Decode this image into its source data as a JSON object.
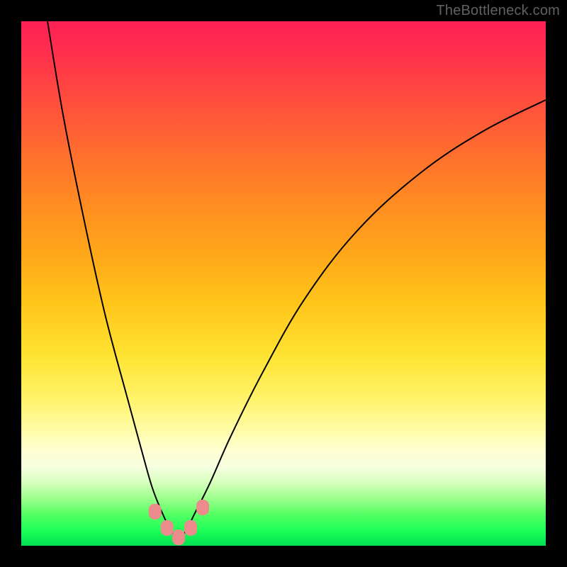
{
  "watermark": "TheBottleneck.com",
  "chart_data": {
    "type": "line",
    "title": "",
    "xlabel": "",
    "ylabel": "",
    "xlim": [
      0,
      100
    ],
    "ylim": [
      0,
      100
    ],
    "grid": false,
    "legend": false,
    "background_gradient": {
      "direction": "vertical",
      "stops": [
        {
          "pos": 0.0,
          "color": "#ff1f55"
        },
        {
          "pos": 0.3,
          "color": "#ff7a28"
        },
        {
          "pos": 0.55,
          "color": "#ffc61a"
        },
        {
          "pos": 0.75,
          "color": "#fff36a"
        },
        {
          "pos": 0.85,
          "color": "#feffd2"
        },
        {
          "pos": 0.92,
          "color": "#9cff8c"
        },
        {
          "pos": 1.0,
          "color": "#00e053"
        }
      ]
    },
    "series": [
      {
        "name": "bottleneck-curve",
        "x": [
          5,
          8,
          12,
          16,
          20,
          23,
          25,
          27,
          28.5,
          30,
          31.5,
          33,
          36,
          40,
          46,
          54,
          64,
          76,
          88,
          100
        ],
        "y": [
          100,
          82,
          62,
          44,
          29,
          18,
          11,
          6,
          3,
          1.5,
          3,
          6,
          12,
          21,
          33,
          47,
          60,
          71,
          79,
          85
        ]
      }
    ],
    "markers": [
      {
        "x": 25.5,
        "y": 6.5
      },
      {
        "x": 27.8,
        "y": 3.4
      },
      {
        "x": 30.0,
        "y": 1.6
      },
      {
        "x": 32.3,
        "y": 3.4
      },
      {
        "x": 34.6,
        "y": 7.3
      }
    ],
    "marker_style": {
      "shape": "rounded-rect",
      "color": "#ec8b8b",
      "size": 18
    }
  }
}
